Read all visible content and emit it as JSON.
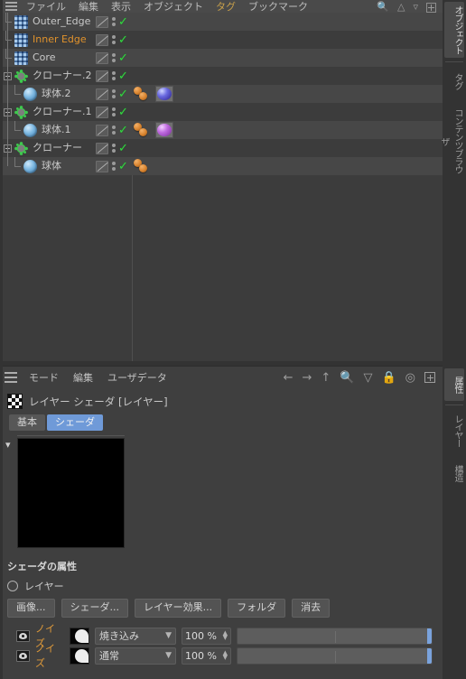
{
  "menubar": {
    "hamburger": "menu-icon",
    "items": [
      {
        "label": "ファイル",
        "accent": false
      },
      {
        "label": "編集",
        "accent": false
      },
      {
        "label": "表示",
        "accent": false
      },
      {
        "label": "オブジェクト",
        "accent": false
      },
      {
        "label": "タグ",
        "accent": true
      },
      {
        "label": "ブックマーク",
        "accent": false
      }
    ],
    "icons": [
      "search-icon",
      "filter-icon",
      "funnel-icon",
      "add-icon"
    ]
  },
  "object_manager": {
    "rows": [
      {
        "name": "Outer_Edge",
        "icon": "edge-object-icon",
        "highlight": false,
        "depth": 1,
        "expander": false,
        "materials": 0,
        "swatch": "none"
      },
      {
        "name": "Inner Edge",
        "icon": "edge-object-icon",
        "highlight": true,
        "depth": 1,
        "expander": false,
        "materials": 0,
        "swatch": "none"
      },
      {
        "name": "Core",
        "icon": "edge-object-icon",
        "highlight": false,
        "depth": 1,
        "expander": false,
        "materials": 0,
        "swatch": "none"
      },
      {
        "name": "クローナー.2",
        "icon": "cloner-icon",
        "highlight": false,
        "depth": 0,
        "expander": true,
        "materials": 0,
        "swatch": "none"
      },
      {
        "name": "球体.2",
        "icon": "sphere-icon",
        "highlight": false,
        "depth": 2,
        "expander": false,
        "materials": 2,
        "swatch": "blue"
      },
      {
        "name": "クローナー.1",
        "icon": "cloner-icon",
        "highlight": false,
        "depth": 0,
        "expander": true,
        "materials": 0,
        "swatch": "none"
      },
      {
        "name": "球体.1",
        "icon": "sphere-icon",
        "highlight": false,
        "depth": 2,
        "expander": false,
        "materials": 2,
        "swatch": "pink"
      },
      {
        "name": "クローナー",
        "icon": "cloner-icon",
        "highlight": false,
        "depth": 0,
        "expander": true,
        "materials": 0,
        "swatch": "none"
      },
      {
        "name": "球体",
        "icon": "sphere-icon",
        "highlight": false,
        "depth": 2,
        "expander": false,
        "materials": 2,
        "swatch": "none"
      }
    ]
  },
  "attribute_manager": {
    "menu": [
      {
        "label": "モード"
      },
      {
        "label": "編集"
      },
      {
        "label": "ユーザデータ"
      }
    ],
    "nav_icons": [
      "back-arrow-icon",
      "forward-arrow-icon",
      "up-arrow-icon",
      "search-icon",
      "filter-icon",
      "lock-icon",
      "target-icon",
      "add-icon"
    ],
    "object_title": "レイヤー シェーダ [レイヤー]",
    "object_icon": "checker-texture-icon",
    "tabs": [
      {
        "label": "基本",
        "active": false
      },
      {
        "label": "シェーダ",
        "active": true
      }
    ],
    "preview": {
      "color": "#000000",
      "collapse_icon": "chevron-down-icon"
    },
    "section_title": "シェーダの属性",
    "layer_label": "レイヤー",
    "buttons": [
      {
        "label": "画像..."
      },
      {
        "label": "シェーダ..."
      },
      {
        "label": "レイヤー効果..."
      },
      {
        "label": "フォルダ"
      },
      {
        "label": "消去"
      }
    ],
    "noise_layers": [
      {
        "visible_icon": "eye-icon",
        "name": "ノイズ",
        "thumbnail": "noise-thumbnail",
        "blend_mode": "焼き込み",
        "opacity": "100 %",
        "opacity_value": 100
      },
      {
        "visible_icon": "eye-icon",
        "name": "ノイズ",
        "thumbnail": "noise-thumbnail",
        "blend_mode": "通常",
        "opacity": "100 %",
        "opacity_value": 100
      }
    ]
  },
  "right_tabs_top": [
    {
      "label": "オブジェクト",
      "active": true
    },
    {
      "label": "タグ",
      "active": false
    },
    {
      "label": "コンテンツブラウザ",
      "active": false
    }
  ],
  "right_tabs_bottom": [
    {
      "label": "属性",
      "active": true
    },
    {
      "label": "レイヤー",
      "active": false
    },
    {
      "label": "構造",
      "active": false
    }
  ],
  "colors": {
    "accent_orange": "#e0922c",
    "accent_blue": "#6f9ad8",
    "check_green": "#35d442",
    "panel_bg": "#3f3f3f",
    "row_light": "#474747",
    "row_dark": "#3c3c3c"
  }
}
